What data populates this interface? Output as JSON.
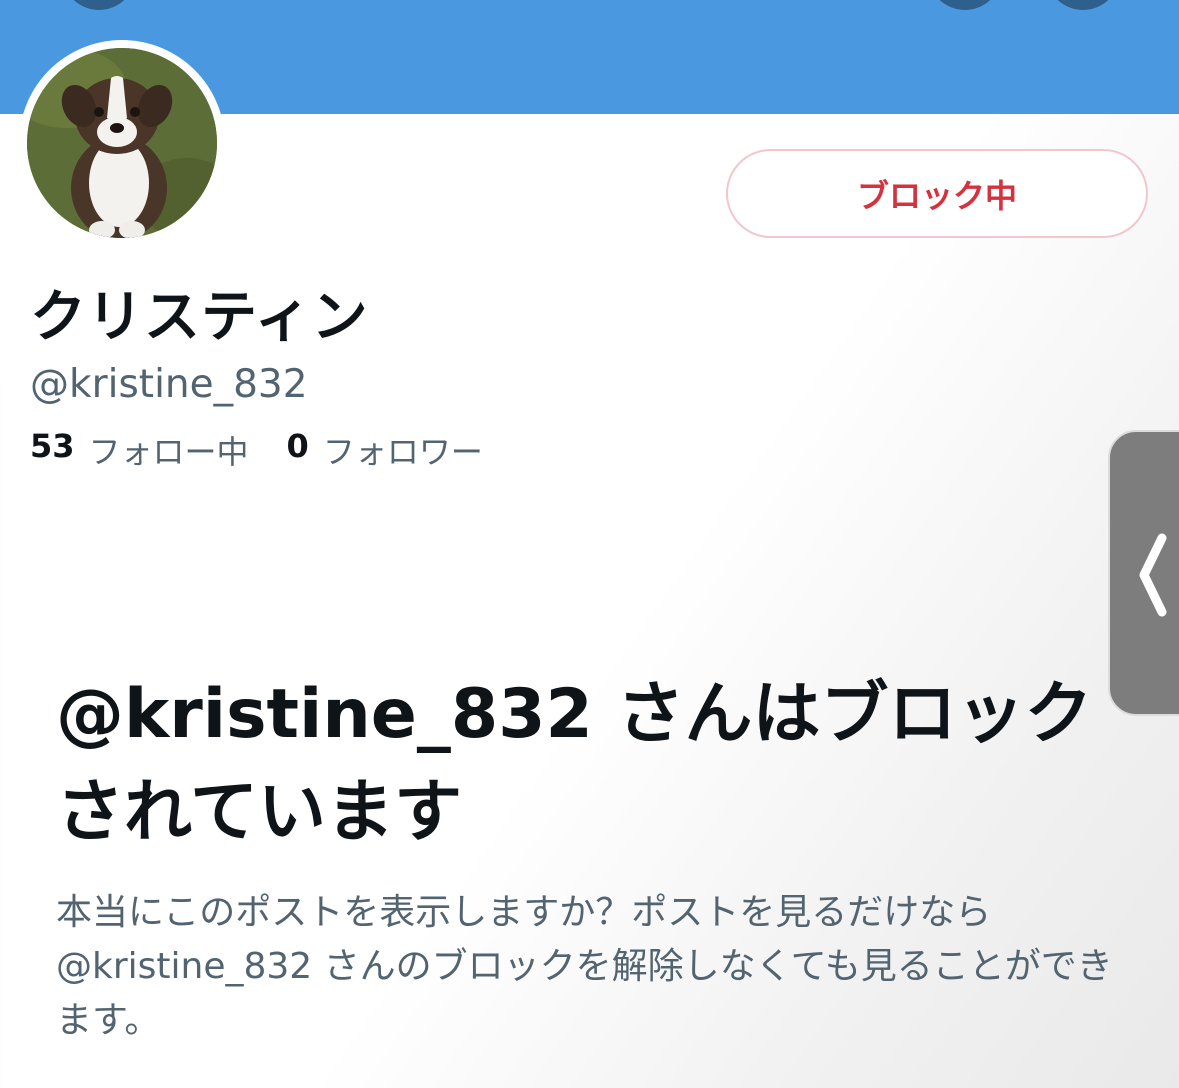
{
  "profile": {
    "display_name": "クリスティン",
    "handle": "@kristine_832",
    "following_count": "53",
    "following_label": "フォロー中",
    "followers_count": "0",
    "followers_label": "フォロワー"
  },
  "actions": {
    "block_button_label": "ブロック中"
  },
  "blocked_notice": {
    "title": "@kristine_832 さんはブロックされています",
    "description": "本当にこのポストを表示しますか？ポストを見るだけなら @kristine_832 さんのブロックを解除しなくても見ることができます。"
  },
  "colors": {
    "banner": "#4a98e0",
    "block_text": "#d4323f",
    "block_border": "#f2c7cc",
    "secondary_text": "#536471",
    "primary_text": "#0f1419"
  },
  "icons": {
    "side_tab": "chevron-left-icon"
  }
}
